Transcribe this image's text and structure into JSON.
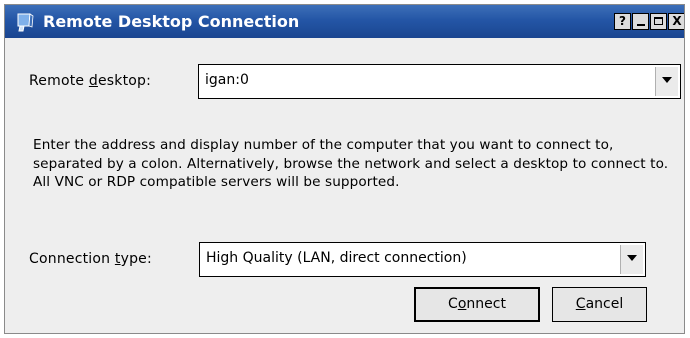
{
  "window": {
    "title": "Remote Desktop Connection",
    "icon": "remote-desktop-app-icon",
    "controls": {
      "help": "?",
      "close": "X"
    }
  },
  "remote_desktop": {
    "label_pre": "Remote ",
    "label_accel": "d",
    "label_post": "esktop:",
    "value": "igan:0"
  },
  "description": "Enter the address and display number of the computer that you want to connect to, separated by a colon. Alternatively, browse the network and select a desktop to connect to. All VNC or RDP compatible servers will be supported.",
  "connection_type": {
    "label_pre": "Connection ",
    "label_accel": "t",
    "label_post": "ype:",
    "selected": "High Quality (LAN, direct connection)"
  },
  "buttons": {
    "connect_pre": "C",
    "connect_accel": "o",
    "connect_post": "nnect",
    "cancel_accel": "C",
    "cancel_post": "ancel"
  }
}
